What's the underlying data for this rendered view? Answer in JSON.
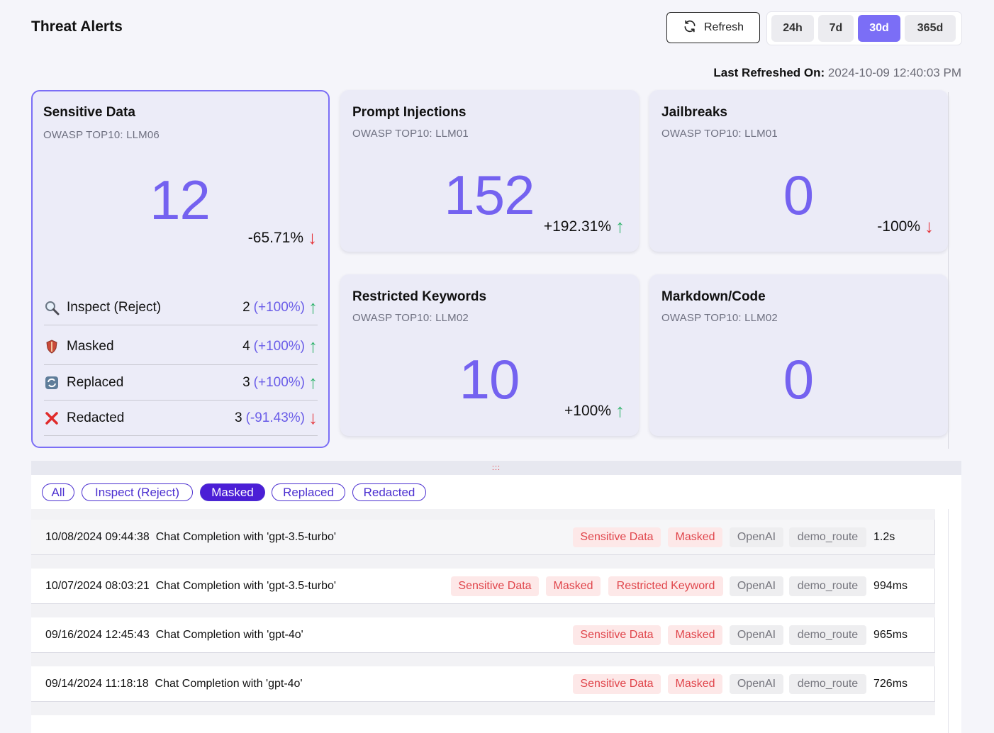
{
  "header": {
    "title": "Threat Alerts",
    "refresh_label": "Refresh",
    "ranges": [
      "24h",
      "7d",
      "30d",
      "365d"
    ],
    "active_range": "30d",
    "last_refreshed_label": "Last Refreshed On:",
    "last_refreshed_value": "2024-10-09 12:40:03 PM"
  },
  "cards": {
    "sensitive": {
      "title": "Sensitive Data",
      "subtitle": "OWASP TOP10: LLM06",
      "count": "12",
      "delta": "-65.71%",
      "trend": "down",
      "breakdown": [
        {
          "label": "Inspect (Reject)",
          "count": "2",
          "pct": "(+100%)",
          "trend": "up",
          "icon": "magnifier-icon"
        },
        {
          "label": "Masked",
          "count": "4",
          "pct": "(+100%)",
          "trend": "up",
          "icon": "shield-icon"
        },
        {
          "label": "Replaced",
          "count": "3",
          "pct": "(+100%)",
          "trend": "up",
          "icon": "replace-icon"
        },
        {
          "label": "Redacted",
          "count": "3",
          "pct": "(-91.43%)",
          "trend": "down",
          "icon": "cross-icon"
        }
      ]
    },
    "prompt": {
      "title": "Prompt Injections",
      "subtitle": "OWASP TOP10: LLM01",
      "count": "152",
      "delta": "+192.31%",
      "trend": "up"
    },
    "jailbreaks": {
      "title": "Jailbreaks",
      "subtitle": "OWASP TOP10: LLM01",
      "count": "0",
      "delta": "-100%",
      "trend": "down"
    },
    "keywords": {
      "title": "Restricted Keywords",
      "subtitle": "OWASP TOP10: LLM02",
      "count": "10",
      "delta": "+100%",
      "trend": "up"
    },
    "markdown": {
      "title": "Markdown/Code",
      "subtitle": "OWASP TOP10: LLM02",
      "count": "0"
    }
  },
  "arrows": {
    "up": "↑",
    "down": "↓"
  },
  "drag_handle": ":::",
  "filters": {
    "items": [
      "All",
      "Inspect (Reject)",
      "Masked",
      "Replaced",
      "Redacted"
    ],
    "active": "Masked"
  },
  "rows": [
    {
      "timestamp": "10/08/2024 09:44:38",
      "description": "Chat Completion with 'gpt-3.5-turbo'",
      "tags": [
        "Sensitive Data",
        "Masked"
      ],
      "provider": "OpenAI",
      "route": "demo_route",
      "latency": "1.2s"
    },
    {
      "timestamp": "10/07/2024 08:03:21",
      "description": "Chat Completion with 'gpt-3.5-turbo'",
      "tags": [
        "Sensitive Data",
        "Masked",
        "Restricted Keyword"
      ],
      "provider": "OpenAI",
      "route": "demo_route",
      "latency": "994ms"
    },
    {
      "timestamp": "09/16/2024 12:45:43",
      "description": "Chat Completion with 'gpt-4o'",
      "tags": [
        "Sensitive Data",
        "Masked"
      ],
      "provider": "OpenAI",
      "route": "demo_route",
      "latency": "965ms"
    },
    {
      "timestamp": "09/14/2024 11:18:18",
      "description": "Chat Completion with 'gpt-4o'",
      "tags": [
        "Sensitive Data",
        "Masked"
      ],
      "provider": "OpenAI",
      "route": "demo_route",
      "latency": "726ms"
    }
  ],
  "colors": {
    "accent": "#7b6ef6",
    "chip": "#4b2fd0",
    "up": "#2fb36b",
    "down": "#e5363c",
    "tag_red": "#e0454b"
  }
}
